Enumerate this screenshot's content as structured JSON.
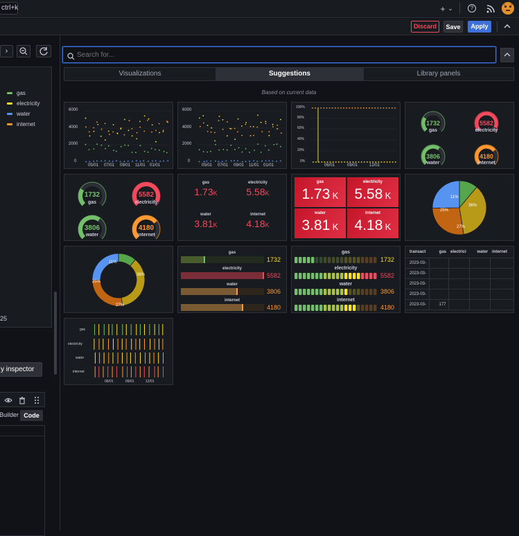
{
  "topbar": {
    "shortcut": "ctrl+k",
    "plus_icon": "+",
    "chevron": "⌄",
    "help_icon": "?",
    "rss_icon": "rss"
  },
  "actions": {
    "discard": "Discard",
    "save": "Save",
    "apply": "Apply"
  },
  "left": {
    "legend": [
      {
        "label": "gas",
        "color": "#73bf69"
      },
      {
        "label": "electricity",
        "color": "#fade2a"
      },
      {
        "label": "water",
        "color": "#5794f2"
      },
      {
        "label": "internet",
        "color": "#ff9830"
      }
    ],
    "partial_value": "25",
    "query_inspector": "y inspector",
    "builder": "Builder",
    "code": "Code"
  },
  "search": {
    "placeholder": "Search for..."
  },
  "tabs": [
    "Visualizations",
    "Suggestions",
    "Library panels"
  ],
  "based_on": "Based on current data",
  "colors": {
    "gas": "#73bf69",
    "electricity": "#f2495c",
    "water": "#5794f2",
    "internet": "#ff9830",
    "yellow": "#fade2a"
  },
  "ts": {
    "yticks": [
      "6000",
      "4000",
      "2000",
      "0"
    ],
    "xticks": [
      "05/01",
      "07/01",
      "09/01",
      "11/01",
      "01/01"
    ],
    "xticks2": [
      "05/01",
      "07/01",
      "09/01",
      "11/01",
      "01/01"
    ],
    "pct_yticks": [
      "100%",
      "80%",
      "60%",
      "40%",
      "20%",
      "0%"
    ],
    "pct_xticks": [
      "06/01",
      "09/01",
      "12/01"
    ]
  },
  "gauges": [
    {
      "label": "gas",
      "value": "1732"
    },
    {
      "label": "electricity",
      "value": "5582"
    },
    {
      "label": "water",
      "value": "3806"
    },
    {
      "label": "internet",
      "value": "4180"
    }
  ],
  "stats": [
    {
      "label": "gas",
      "value": "1.73",
      "unit": "K"
    },
    {
      "label": "electricity",
      "value": "5.58",
      "unit": "K"
    },
    {
      "label": "water",
      "value": "3.81",
      "unit": "K"
    },
    {
      "label": "internet",
      "value": "4.18",
      "unit": "K"
    }
  ],
  "pie": {
    "labels": [
      "11%",
      "36%",
      "27%",
      "25%"
    ]
  },
  "donut": {
    "labels": [
      "11%",
      "36%",
      "27%",
      "25%"
    ]
  },
  "bars": [
    {
      "label": "gas",
      "value": "1732"
    },
    {
      "label": "electricity",
      "value": "5582"
    },
    {
      "label": "water",
      "value": "3806"
    },
    {
      "label": "internet",
      "value": "4180"
    }
  ],
  "table": {
    "headers": [
      "transact",
      "gas",
      "electrici",
      "water",
      "internet"
    ],
    "rows": [
      [
        "2023-03-",
        "",
        "",
        "",
        ""
      ],
      [
        "2023-03-",
        "",
        "",
        "",
        ""
      ],
      [
        "2023-03-",
        "",
        "",
        "",
        ""
      ],
      [
        "2023-03-",
        "",
        "",
        "",
        ""
      ],
      [
        "2023-03-",
        "177",
        "",
        "",
        ""
      ]
    ]
  },
  "state": {
    "labels": [
      "gas",
      "electricity",
      "water",
      "internet"
    ],
    "xticks": [
      "06/01",
      "09/01",
      "12/01"
    ]
  },
  "chart_data": [
    {
      "type": "gauge",
      "categories": [
        "gas",
        "electricity",
        "water",
        "internet"
      ],
      "values": [
        1732,
        5582,
        3806,
        4180
      ]
    },
    {
      "type": "pie",
      "categories": [
        "gas",
        "electricity",
        "water",
        "internet"
      ],
      "values": [
        11,
        36,
        27,
        25
      ]
    }
  ]
}
